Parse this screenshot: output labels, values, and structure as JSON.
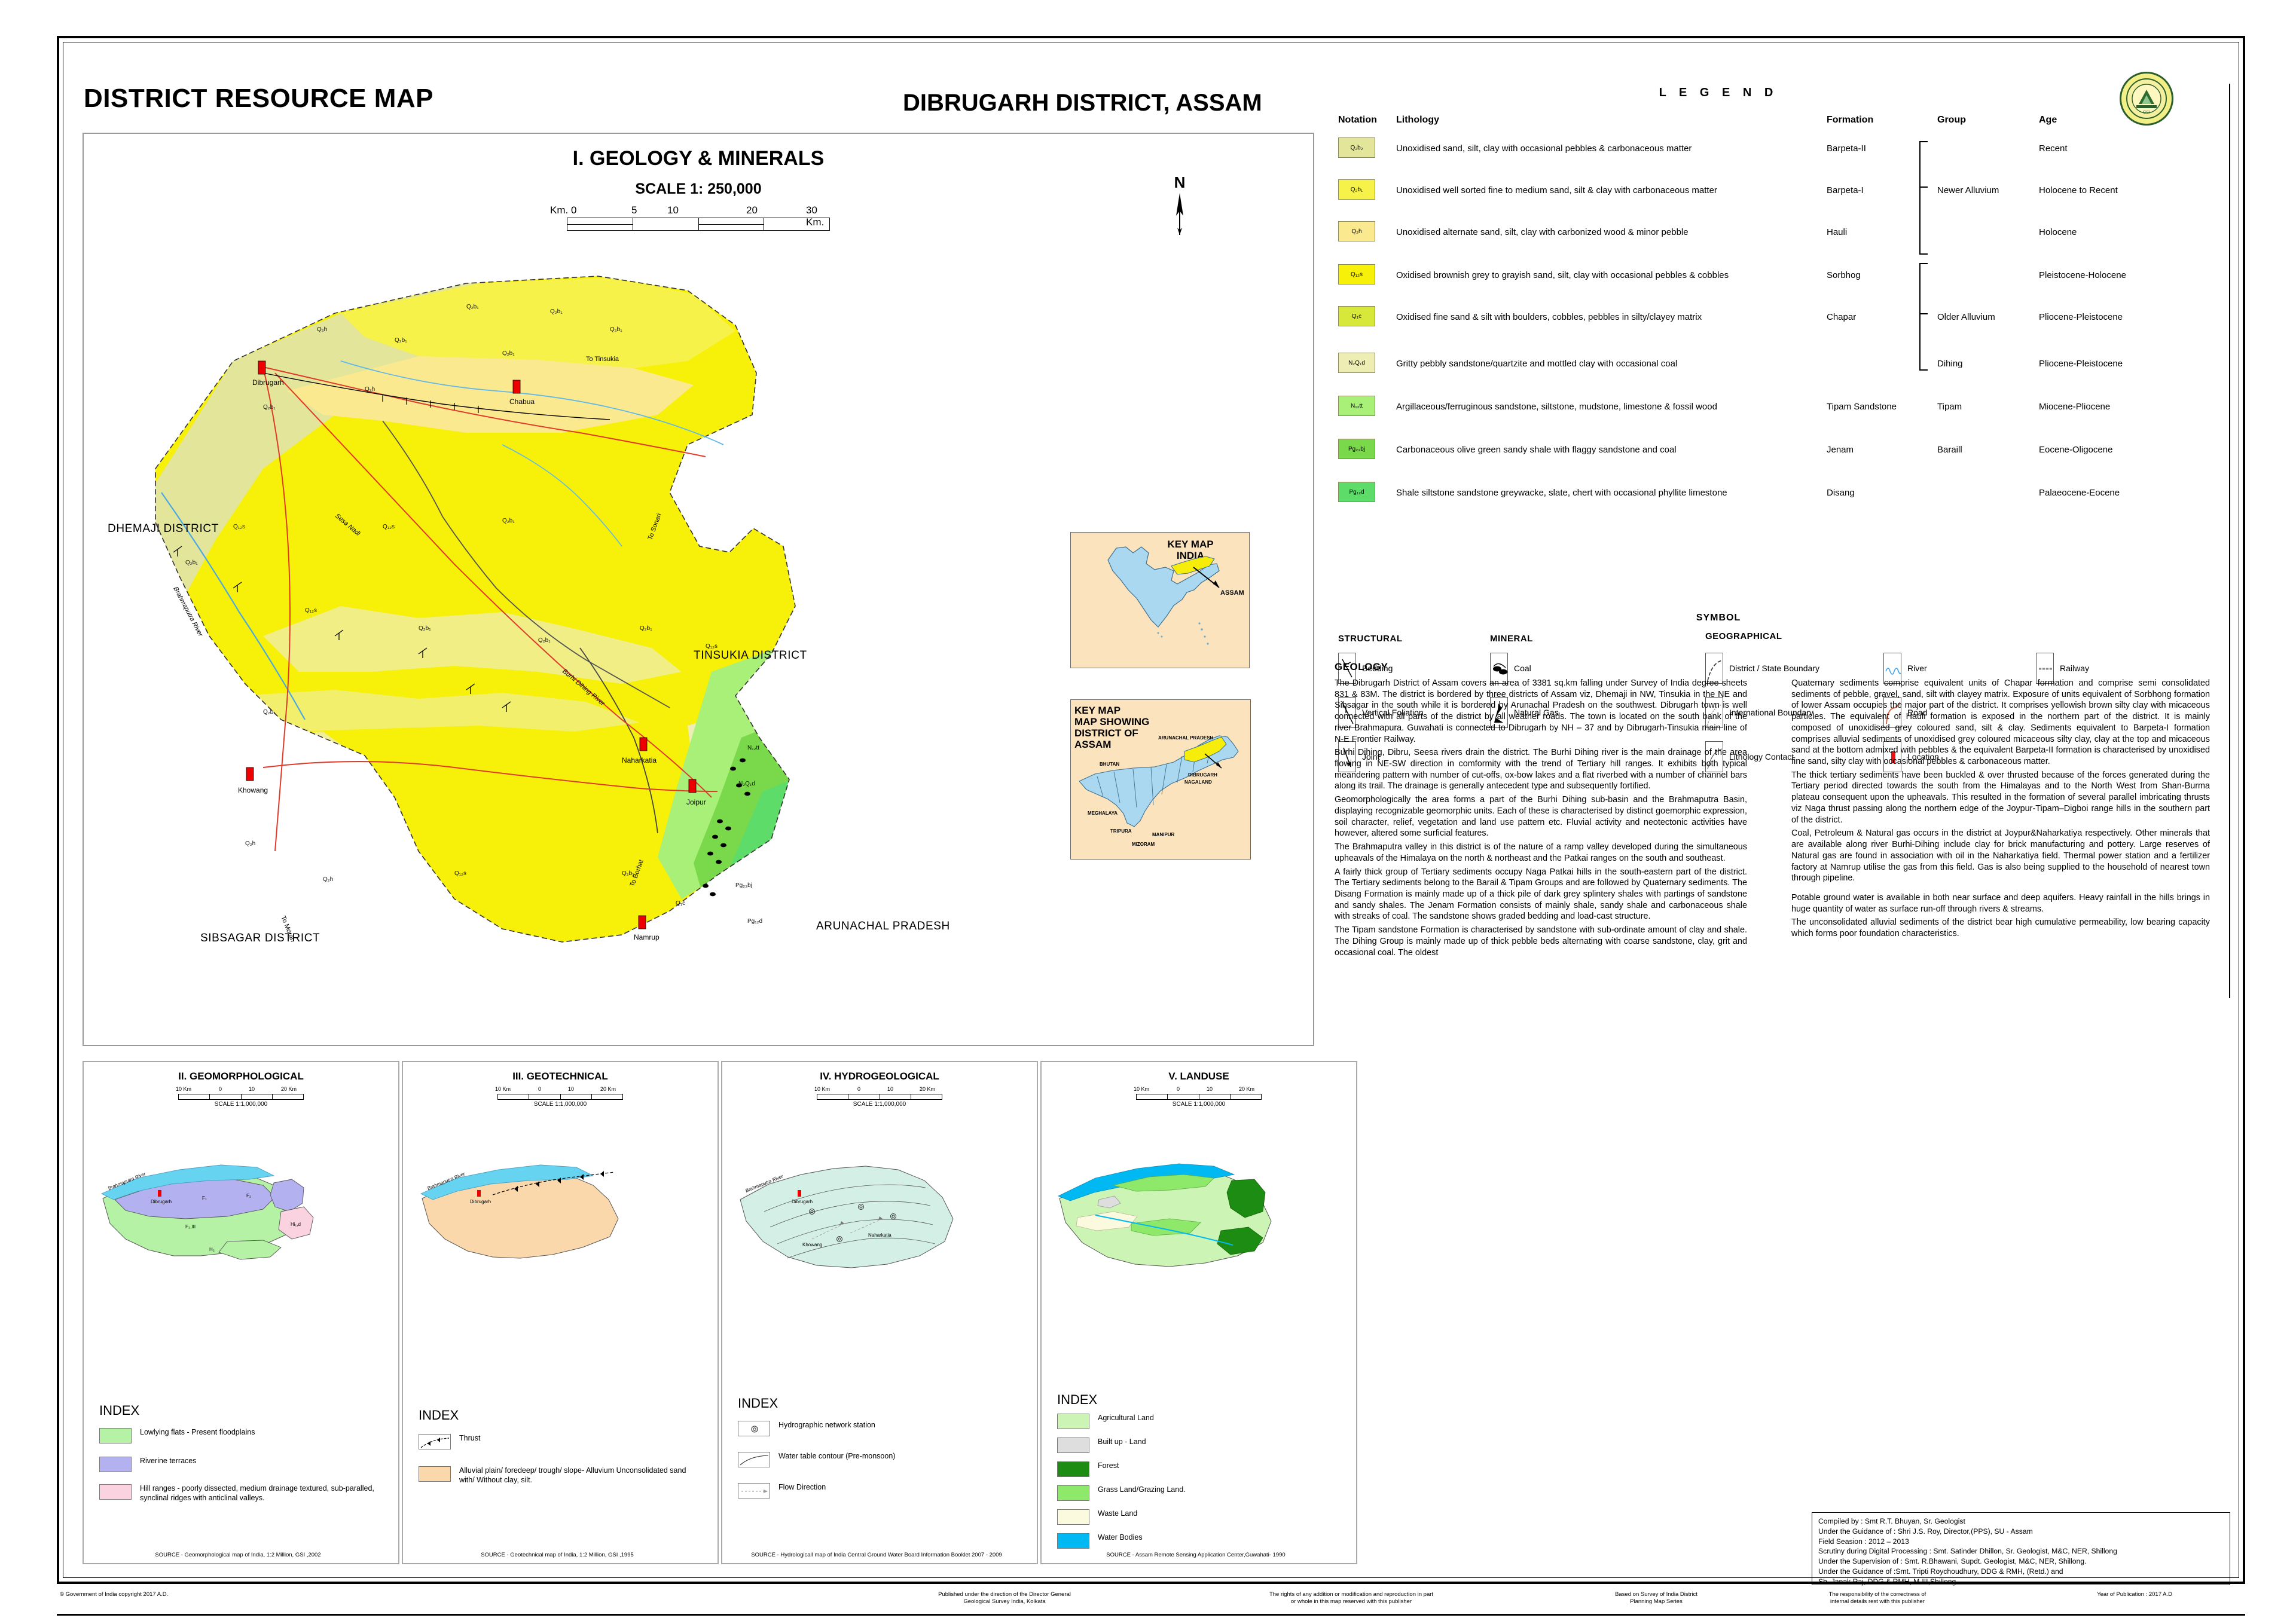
{
  "header": {
    "left_title": "DISTRICT RESOURCE MAP",
    "center_title": "DIBRUGARH DISTRICT, ASSAM",
    "logo_name": "gsi-emblem"
  },
  "main_map": {
    "title": "I. GEOLOGY & MINERALS",
    "scale_label": "SCALE 1: 250,000",
    "scale_ticks": [
      "Km. 0",
      "5",
      "10",
      "20",
      "30 Km."
    ],
    "north_label": "N",
    "district_labels": [
      "DHEMAJI DISTRICT",
      "TINSUKIA DISTRICT",
      "SIBSAGAR DISTRICT",
      "ARUNACHAL PRADESH"
    ],
    "towns": [
      "Dibrugarh",
      "Chabua",
      "Khowang",
      "Naharkatia",
      "Joipur",
      "Namrup"
    ],
    "rivers": [
      "Brahmaputra River",
      "Sesa Nadi",
      "Burhi Dihing River"
    ],
    "road_labels": [
      "To Tinsukia",
      "To Sonari",
      "To Moran",
      "To Borhat"
    ],
    "unit_codes": [
      "Q2b2",
      "Q2b1",
      "Q2h",
      "Q12s",
      "Q1c",
      "N2Q1d",
      "N12tt",
      "Pg23bj",
      "Pg12d"
    ]
  },
  "keymaps": {
    "india": {
      "title_line1": "KEY MAP",
      "title_line2": "INDIA",
      "callout": "ASSAM"
    },
    "assam": {
      "title_line1": "KEY MAP",
      "title_line2": "MAP SHOWING",
      "title_line3": "DISTRICT OF ASSAM",
      "callout": "DIBRUGARH",
      "neighbours": [
        "ARUNACHAL PRADESH",
        "BHUTAN",
        "NAGALAND",
        "MEGHALAYA",
        "TRIPURA",
        "MANIPUR",
        "MIZORAM"
      ]
    }
  },
  "legend": {
    "title": "L E G E N D",
    "columns": [
      "Notation",
      "Lithology",
      "Formation",
      "Group",
      "Age"
    ],
    "rows": [
      {
        "notation": "Q₂b₂",
        "color": "#e2e59a",
        "lithology": "Unoxidised sand, silt, clay with occasional pebbles & carbonaceous matter",
        "formation": "Barpeta-II",
        "group": "",
        "age": "Recent"
      },
      {
        "notation": "Q₂b₁",
        "color": "#f7f24a",
        "lithology": "Unoxidised well sorted fine to medium sand, silt & clay with carbonaceous matter",
        "formation": "Barpeta-I",
        "group": "Newer Alluvium",
        "age": "Holocene to Recent"
      },
      {
        "notation": "Q₂h",
        "color": "#fbe98f",
        "lithology": "Unoxidised alternate sand, silt, clay with carbonized wood & minor pebble",
        "formation": "Hauli",
        "group": "",
        "age": "Holocene"
      },
      {
        "notation": "Q₁₂s",
        "color": "#f7f009",
        "lithology": "Oxidised brownish grey to grayish sand, silt, clay with occasional pebbles & cobbles",
        "formation": "Sorbhog",
        "group": "",
        "age": "Pleistocene-Holocene"
      },
      {
        "notation": "Q₁c",
        "color": "#d8e83a",
        "lithology": "Oxidised fine sand & silt with boulders, cobbles, pebbles in silty/clayey matrix",
        "formation": "Chapar",
        "group": "Older Alluvium",
        "age": "Pliocene-Pleistocene"
      },
      {
        "notation": "N₂Q₁d",
        "color": "#eeedb4",
        "lithology": "Gritty pebbly sandstone/quartzite and mottled clay with occasional coal",
        "formation": "",
        "group": "Dihing",
        "age": "Pliocene-Pleistocene"
      },
      {
        "notation": "N₁₂tt",
        "color": "#a8f078",
        "lithology": "Argillaceous/ferruginous sandstone, siltstone, mudstone, limestone & fossil wood",
        "formation": "Tipam Sandstone",
        "group": "Tipam",
        "age": "Miocene-Pliocene"
      },
      {
        "notation": "Pg₂₃bj",
        "color": "#7ad94a",
        "lithology": "Carbonaceous olive green sandy shale with flaggy sandstone and coal",
        "formation": "Jenam",
        "group": "Baraill",
        "age": "Eocene-Oligocene"
      },
      {
        "notation": "Pg₁₂d",
        "color": "#5ddc6a",
        "lithology": "Shale siltstone sandstone greywacke, slate, chert with occasional phyllite limestone",
        "formation": "Disang",
        "group": "",
        "age": "Palaeocene-Eocene"
      }
    ],
    "braces": [
      {
        "label": "Newer Alluvium"
      },
      {
        "label": "Older Alluvium"
      }
    ]
  },
  "symbols": {
    "title": "SYMBOL",
    "structural": {
      "heading": "STRUCTURAL",
      "items": [
        {
          "label": "Bedding",
          "icon": "bedding-icon"
        },
        {
          "label": "Vertical Foliation",
          "icon": "vertical-foliation-icon"
        },
        {
          "label": "Joint",
          "icon": "joint-icon"
        }
      ]
    },
    "mineral": {
      "heading": "MINERAL",
      "items": [
        {
          "label": "Coal",
          "icon": "coal-icon"
        },
        {
          "label": "Natural Gas",
          "icon": "natural-gas-icon"
        }
      ]
    },
    "geographical": {
      "heading": "GEOGRAPHICAL",
      "items": [
        {
          "label": "District / State Boundary",
          "icon": "district-boundary-icon"
        },
        {
          "label": "International Boundary",
          "icon": "international-boundary-icon"
        },
        {
          "label": "Lithology Contact",
          "icon": "lithology-contact-icon"
        },
        {
          "label": "River",
          "icon": "river-icon"
        },
        {
          "label": "Road",
          "icon": "road-icon"
        },
        {
          "label": "Location",
          "icon": "location-icon"
        },
        {
          "label": "Railway",
          "icon": "railway-icon"
        }
      ]
    }
  },
  "geology": {
    "heading": "GEOLOGY",
    "col1": [
      "The Dibrugarh District of Assam covers an area of 3381 sq.km falling under Survey of India degree sheets 831 & 83M. The district is bordered by three districts of Assam viz, Dhemaji in NW, Tinsukia in the NE and Sibsagar in the south while it is bordered by Arunachal Pradesh on the southwest. Dibrugarh town is well connected with all parts of the district by all weather roads. The town is located on the south bank of the river Brahmapura. Guwahati is connected to Dibrugarh by NH – 37 and by Dibrugarh-Tinsukia main line of N-E Frontier Railway.",
      "Burhi Dihing, Dibru, Seesa rivers drain the district. The Burhi Dihing river is the main drainage of the area flowing in NE-SW direction in comformity with the trend of Tertiary hill ranges. It exhibits both typical meandering pattern with number of cut-offs, ox-bow lakes and a flat riverbed with a number of channel bars along its trail. The drainage is generally antecedent type and subsequently fortified.",
      "Geomorphologically the area forms a part of the Burhi Dihing sub-basin and the Brahmaputra Basin, displaying recognizable geomorphic units. Each of these is characterised by distinct goemorphic expression, soil character, relief, vegetation and land use pattern etc. Fluvial activity and neotectonic activities have however, altered some surficial features.",
      "The Brahmaputra valley in this district is of the nature of a ramp valley developed during the simultaneous upheavals of the Himalaya on the north & northeast and the Patkai ranges on the south and southeast.",
      "A fairly thick group of Tertiary sediments occupy Naga Patkai hills in the south-eastern part of the district. The Tertiary sediments belong to the Barail & Tipam Groups and are followed by Quaternary sediments. The Disang Formation is mainly made up of a thick pile of dark grey splintery shales with partings of sandstone and sandy shales. The Jenam Formation consists of mainly shale, sandy shale and carbonaceous shale with streaks of coal. The sandstone shows graded bedding and load-cast structure.",
      "The Tipam sandstone Formation is characterised by sandstone with sub-ordinate amount of clay and shale. The Dihing Group is mainly made up of thick pebble beds alternating with coarse sandstone, clay, grit and occasional coal. The oldest"
    ],
    "col2": [
      "Quaternary sediments comprise equivalent units of Chapar formation and comprise semi consolidated sediments of pebble, gravel, sand, silt with clayey matrix. Exposure of units equivalent of Sorbhong formation of lower Assam occupies the major part of the district. It comprises yellowish brown silty clay with micaceous particles. The equivalent of Hauli formation is exposed in the northern part of the district. It is mainly composed of unoxidised grey coloured sand, silt & clay. Sediments equivalent to Barpeta-I formation comprises alluvial sediments of unoxidised grey coloured micaceous silty clay, clay at the top and micaceous sand at the bottom admixed with pebbles & the equivalent Barpeta-II formation is characterised by unoxidised fine sand, silty clay with occasional pebbles & carbonaceous matter.",
      "The thick tertiary sediments have been buckled & over thrusted because of the forces generated during the Tertiary period directed towards the south from the Himalayas and to the North West from Shan-Burma plateau consequent upon the upheavals. This resulted in the formation of several parallel imbricating thrusts viz Naga thrust passing along the northern edge of the Joypur-Tipam–Digboi range hills in the southern part of the district.",
      "Coal, Petroleum & Natural gas occurs in the district at Joypur&Naharkatiya respectively. Other minerals that are available along river Burhi-Dihing include clay for brick manufacturing and pottery. Large reserves of Natural gas are found in association with oil in the Naharkatiya field. Thermal power station and a fertilizer factory at Namrup utilise the gas from this field. Gas is also being supplied to the household of nearest town through pipeline.",
      "Potable ground water is available in both near surface and deep aquifers. Heavy rainfall in the hills brings in huge quantity of water as surface run-off through rivers & streams.",
      "The unconsolidated alluvial sediments of the district bear high cumulative permeability, low bearing capacity which forms poor foundation characteristics."
    ]
  },
  "submaps": [
    {
      "title": "II. GEOMORPHOLOGICAL",
      "scale_ticks": [
        "10 Km",
        "0",
        "10",
        "20 Km"
      ],
      "scale_text": "SCALE 1:1,000,000",
      "index_title": "INDEX",
      "legend": [
        {
          "color": "#b6f2a5",
          "label": "Lowlying flats - Present floodplains",
          "type": "swatch"
        },
        {
          "color": "#b3b1f0",
          "label": "Riverine terraces",
          "type": "swatch"
        },
        {
          "color": "#fbd2e0",
          "label": "Hill ranges - poorly dissected, medium drainage textured, sub-paralled, synclinal ridges with anticlinal valleys.",
          "type": "swatch"
        }
      ],
      "source": "SOURCE - Geomorphological map of India, 1:2 Million, GSI ,2002",
      "map_labels": [
        "Brahmaputra River",
        "Dibrugarh",
        "F-1",
        "F-2",
        "Hi-1",
        "Hi-2"
      ]
    },
    {
      "title": "III. GEOTECHNICAL",
      "scale_ticks": [
        "10 Km",
        "0",
        "10",
        "20 Km"
      ],
      "scale_text": "SCALE 1:1,000,000",
      "index_title": "INDEX",
      "legend": [
        {
          "color": "#ffffff",
          "label": "Thrust",
          "type": "thrust"
        },
        {
          "color": "#fad8ab",
          "label": "Alluvial plain/ foredeep/ trough/ slope- Alluvium Unconsolidated sand with/ Without clay, silt.",
          "type": "swatch"
        }
      ],
      "source": "SOURCE - Geotechnical map of India, 1:2 Million, GSI ,1995",
      "map_labels": [
        "Brahmaputra River",
        "Dibrugarh"
      ]
    },
    {
      "title": "IV. HYDROGEOLOGICAL",
      "scale_ticks": [
        "10 Km",
        "0",
        "10",
        "20 Km"
      ],
      "scale_text": "SCALE 1:1,000,000",
      "index_title": "INDEX",
      "legend": [
        {
          "color": "#ffffff",
          "label": "Hydrographic network station",
          "type": "station"
        },
        {
          "color": "#ffffff",
          "label": "Water table contour (Pre-monsoon)",
          "type": "contour"
        },
        {
          "color": "#ffffff",
          "label": "Flow Direction",
          "type": "flow"
        }
      ],
      "source": "SOURCE - Hydrologicall map of India Central Ground Water Board Information Booklet 2007 - 2009",
      "map_labels": [
        "Brahmaputra River",
        "Dibrugarh",
        "Khowang",
        "Naharkatia"
      ]
    },
    {
      "title": "V. LANDUSE",
      "scale_ticks": [
        "10 Km",
        "0",
        "10",
        "20 Km"
      ],
      "scale_text": "SCALE 1:1,000,000",
      "index_title": "INDEX",
      "legend": [
        {
          "color": "#ccf5b5",
          "label": "Agricultural Land",
          "type": "swatch"
        },
        {
          "color": "#dedede",
          "label": "Built up - Land",
          "type": "swatch"
        },
        {
          "color": "#1d8c13",
          "label": "Forest",
          "type": "swatch"
        },
        {
          "color": "#8ee86a",
          "label": "Grass Land/Grazing Land.",
          "type": "swatch"
        },
        {
          "color": "#fbfade",
          "label": "Waste Land",
          "type": "swatch"
        },
        {
          "color": "#00b9f2",
          "label": "Water Bodies",
          "type": "swatch"
        }
      ],
      "source": "SOURCE - Assam Remote Sensing Application Center,Guwahati- 1990",
      "map_labels": []
    }
  ],
  "credits": [
    "Compiled by  : Smt R.T. Bhuyan, Sr. Geologist",
    "Under the Guidance of : Shri J.S. Roy, Director,(PPS), SU - Assam",
    "Field Seasion : 2012 – 2013",
    "Scrutiny during Digital Processing : Smt. Satinder Dhillon, Sr. Geologist, M&C, NER, Shillong",
    "Under the Supervision of : Smt. R.Bhawani, Supdt. Geologist, M&C, NER, Shillong.",
    "Under the Guidance of  :Smt. Tripti Roychoudhury, DDG & RMH, (Retd.) and",
    "Sh. Janak Raj, DDG & RMH, M-III,Shillong"
  ],
  "footer": {
    "copyright": "© Government of India copyright 2017 A.D.",
    "published_line1": "Published under the direction of the Director General",
    "published_line2": "Geological Survey India, Kolkata",
    "responsibility_line1": "The responsibility  of the correctness of",
    "responsibility_line2": "internal details rest with this publisher",
    "rights_line1": "The rights of any addition or modification and reproduction in part",
    "rights_line2": "or whole in this map reserved with this publisher",
    "based_line1": "Based on Survey of India District",
    "based_line2": "Planning Map Series",
    "year": "Year of Publication : 2017 A.D"
  }
}
